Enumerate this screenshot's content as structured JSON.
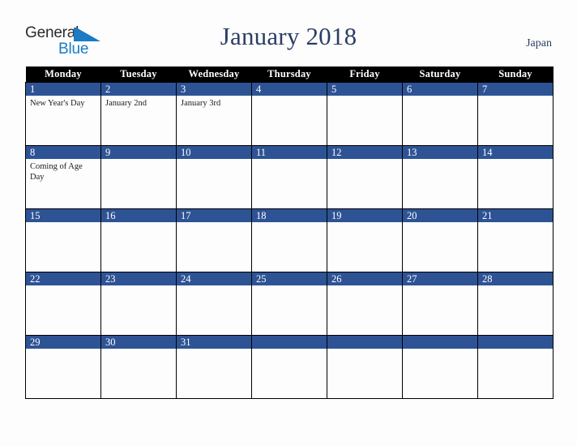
{
  "logo": {
    "word_general": "General",
    "word_blue": "Blue",
    "triangle_icon": "blue-triangle-icon",
    "color_general": "#2b2b2b",
    "color_blue": "#1b7bc4"
  },
  "header": {
    "title": "January 2018",
    "region": "Japan",
    "title_color": "#2c3e63"
  },
  "calendar": {
    "weekdays": [
      "Monday",
      "Tuesday",
      "Wednesday",
      "Thursday",
      "Friday",
      "Saturday",
      "Sunday"
    ],
    "header_bg": "#000000",
    "date_band_bg": "#2e5395",
    "cell_bg": "#fdfdfd",
    "weeks": [
      {
        "days": [
          {
            "date": "1",
            "event": "New Year's Day"
          },
          {
            "date": "2",
            "event": "January 2nd"
          },
          {
            "date": "3",
            "event": "January 3rd"
          },
          {
            "date": "4",
            "event": ""
          },
          {
            "date": "5",
            "event": ""
          },
          {
            "date": "6",
            "event": ""
          },
          {
            "date": "7",
            "event": ""
          }
        ]
      },
      {
        "days": [
          {
            "date": "8",
            "event": "Coming of Age Day"
          },
          {
            "date": "9",
            "event": ""
          },
          {
            "date": "10",
            "event": ""
          },
          {
            "date": "11",
            "event": ""
          },
          {
            "date": "12",
            "event": ""
          },
          {
            "date": "13",
            "event": ""
          },
          {
            "date": "14",
            "event": ""
          }
        ]
      },
      {
        "days": [
          {
            "date": "15",
            "event": ""
          },
          {
            "date": "16",
            "event": ""
          },
          {
            "date": "17",
            "event": ""
          },
          {
            "date": "18",
            "event": ""
          },
          {
            "date": "19",
            "event": ""
          },
          {
            "date": "20",
            "event": ""
          },
          {
            "date": "21",
            "event": ""
          }
        ]
      },
      {
        "days": [
          {
            "date": "22",
            "event": ""
          },
          {
            "date": "23",
            "event": ""
          },
          {
            "date": "24",
            "event": ""
          },
          {
            "date": "25",
            "event": ""
          },
          {
            "date": "26",
            "event": ""
          },
          {
            "date": "27",
            "event": ""
          },
          {
            "date": "28",
            "event": ""
          }
        ]
      },
      {
        "days": [
          {
            "date": "29",
            "event": ""
          },
          {
            "date": "30",
            "event": ""
          },
          {
            "date": "31",
            "event": ""
          },
          {
            "date": "",
            "event": ""
          },
          {
            "date": "",
            "event": ""
          },
          {
            "date": "",
            "event": ""
          },
          {
            "date": "",
            "event": ""
          }
        ]
      }
    ]
  }
}
